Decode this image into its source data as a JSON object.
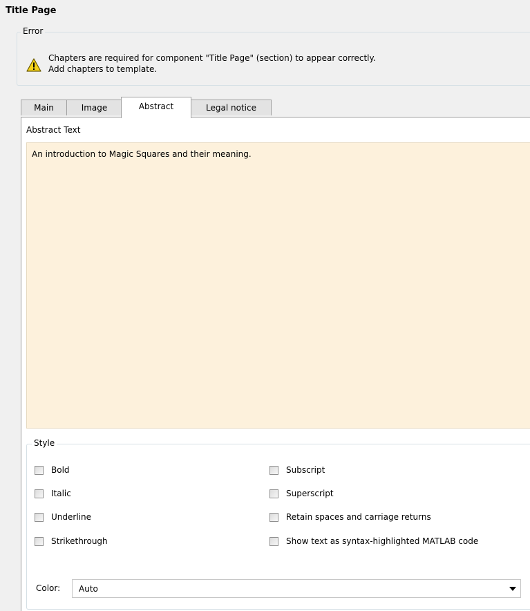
{
  "page_title": "Title Page",
  "error": {
    "legend": "Error",
    "line1": "Chapters are required for component \"Title Page\" (section) to appear correctly.",
    "line2": "Add chapters to template.",
    "icon": "warning-icon"
  },
  "tabs": [
    {
      "label": "Main"
    },
    {
      "label": "Image"
    },
    {
      "label": "Abstract"
    },
    {
      "label": "Legal notice"
    }
  ],
  "active_tab": "Abstract",
  "abstract": {
    "label": "Abstract Text",
    "text": "An introduction to Magic Squares and their meaning.",
    "background": "#fdf1dc"
  },
  "style": {
    "legend": "Style",
    "left_options": [
      {
        "label": "Bold",
        "checked": false
      },
      {
        "label": "Italic",
        "checked": false
      },
      {
        "label": "Underline",
        "checked": false
      },
      {
        "label": "Strikethrough",
        "checked": false
      }
    ],
    "right_options": [
      {
        "label": "Subscript",
        "checked": false
      },
      {
        "label": "Superscript",
        "checked": false
      },
      {
        "label": "Retain spaces and carriage returns",
        "checked": false
      },
      {
        "label": "Show text as syntax-highlighted MATLAB code",
        "checked": false
      }
    ]
  },
  "color": {
    "label": "Color:",
    "value": "Auto"
  }
}
